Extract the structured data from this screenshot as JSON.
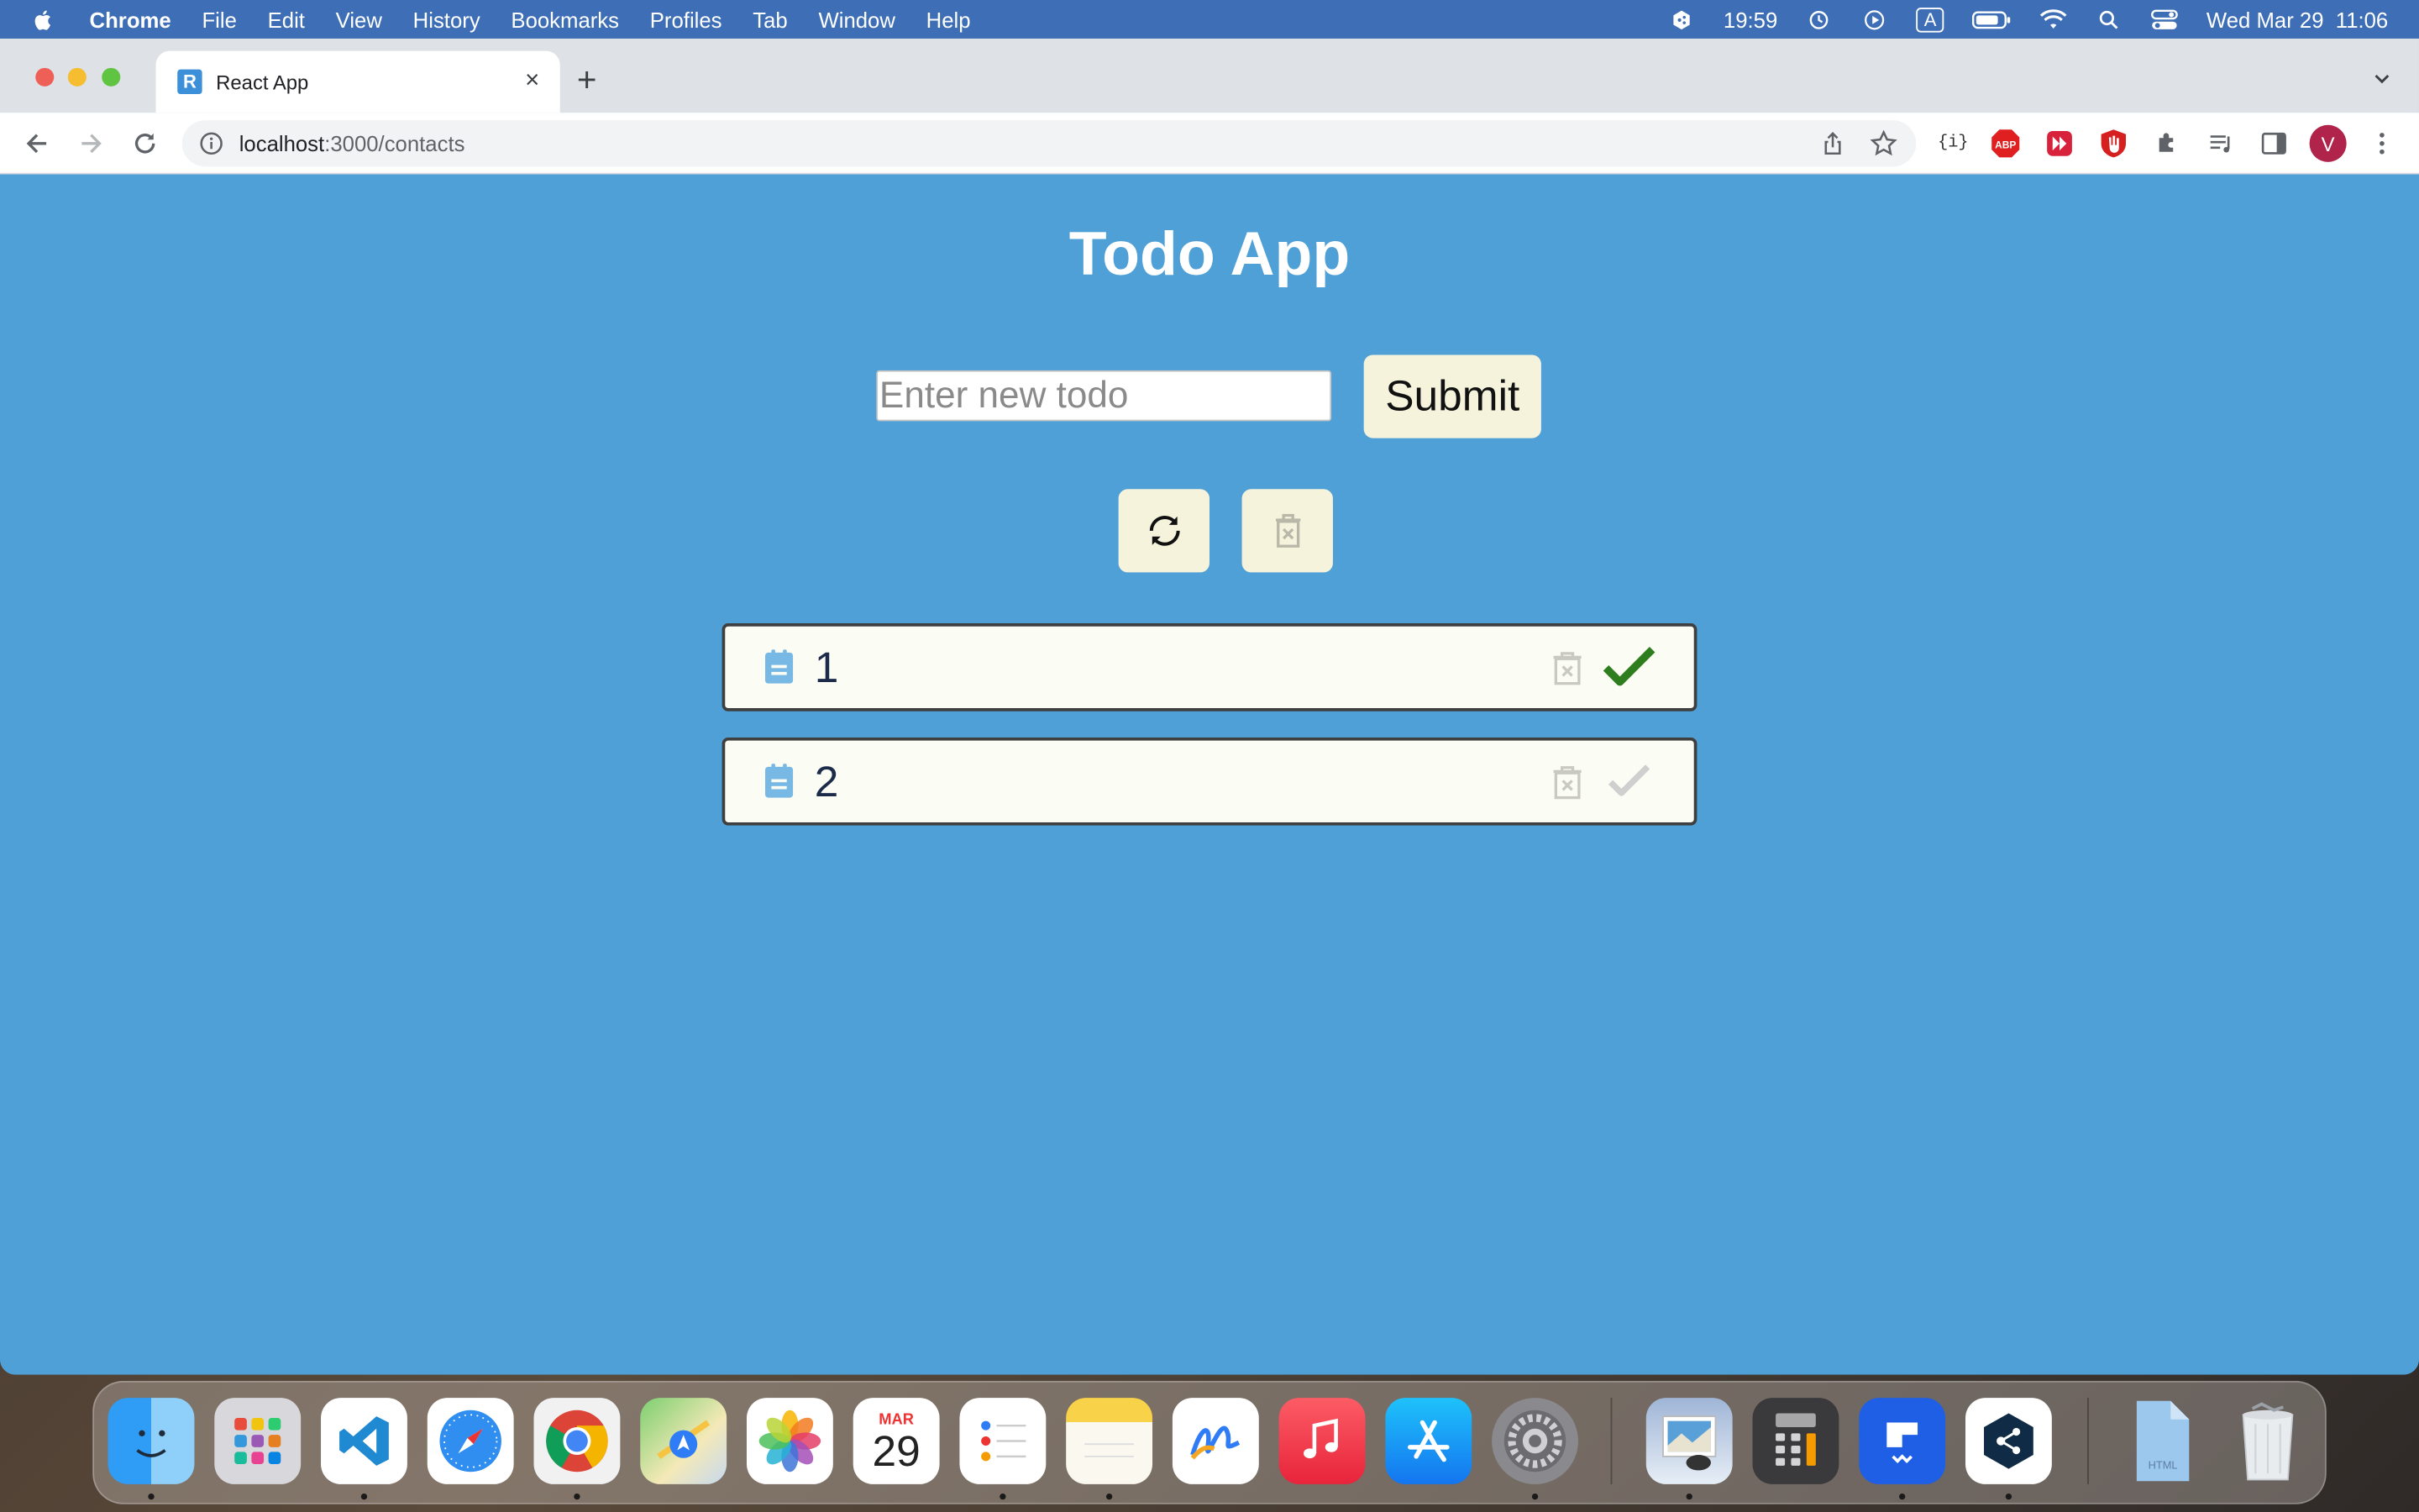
{
  "menubar": {
    "app_name": "Chrome",
    "items": [
      "File",
      "Edit",
      "View",
      "History",
      "Bookmarks",
      "Profiles",
      "Tab",
      "Window",
      "Help"
    ],
    "timer": "19:59",
    "input_source": "A",
    "datetime": "Wed Mar 29  11:06"
  },
  "browser": {
    "tab_title": "React App",
    "tab_favicon": "R",
    "new_tab": "+",
    "url_host": "localhost",
    "url_path": ":3000/contacts",
    "profile_initial": "V"
  },
  "app": {
    "title": "Todo App",
    "input_placeholder": "Enter new todo",
    "input_value": "",
    "submit_label": "Submit",
    "refresh_icon": "refresh-icon",
    "clear_icon": "trash-x-icon",
    "todos": [
      {
        "text": "1",
        "completed": true
      },
      {
        "text": "2",
        "completed": false
      }
    ]
  },
  "colors": {
    "page_background": "#4fa0d6",
    "button_background": "#f5f3dc",
    "check_done": "#2e7d1e",
    "check_pending": "#cfcfcf",
    "menubar": "#3e6fb6"
  },
  "dock": {
    "calendar_month": "MAR",
    "calendar_day": "29",
    "apps": [
      "Finder",
      "Launchpad",
      "Visual Studio Code",
      "Safari",
      "Google Chrome",
      "Maps",
      "Photos",
      "Calendar",
      "Reminders",
      "Notes",
      "Freeform",
      "Music",
      "App Store",
      "System Settings",
      "Preview",
      "Calculator",
      "Frame",
      "DeepL",
      "HTML",
      "Trash"
    ]
  }
}
